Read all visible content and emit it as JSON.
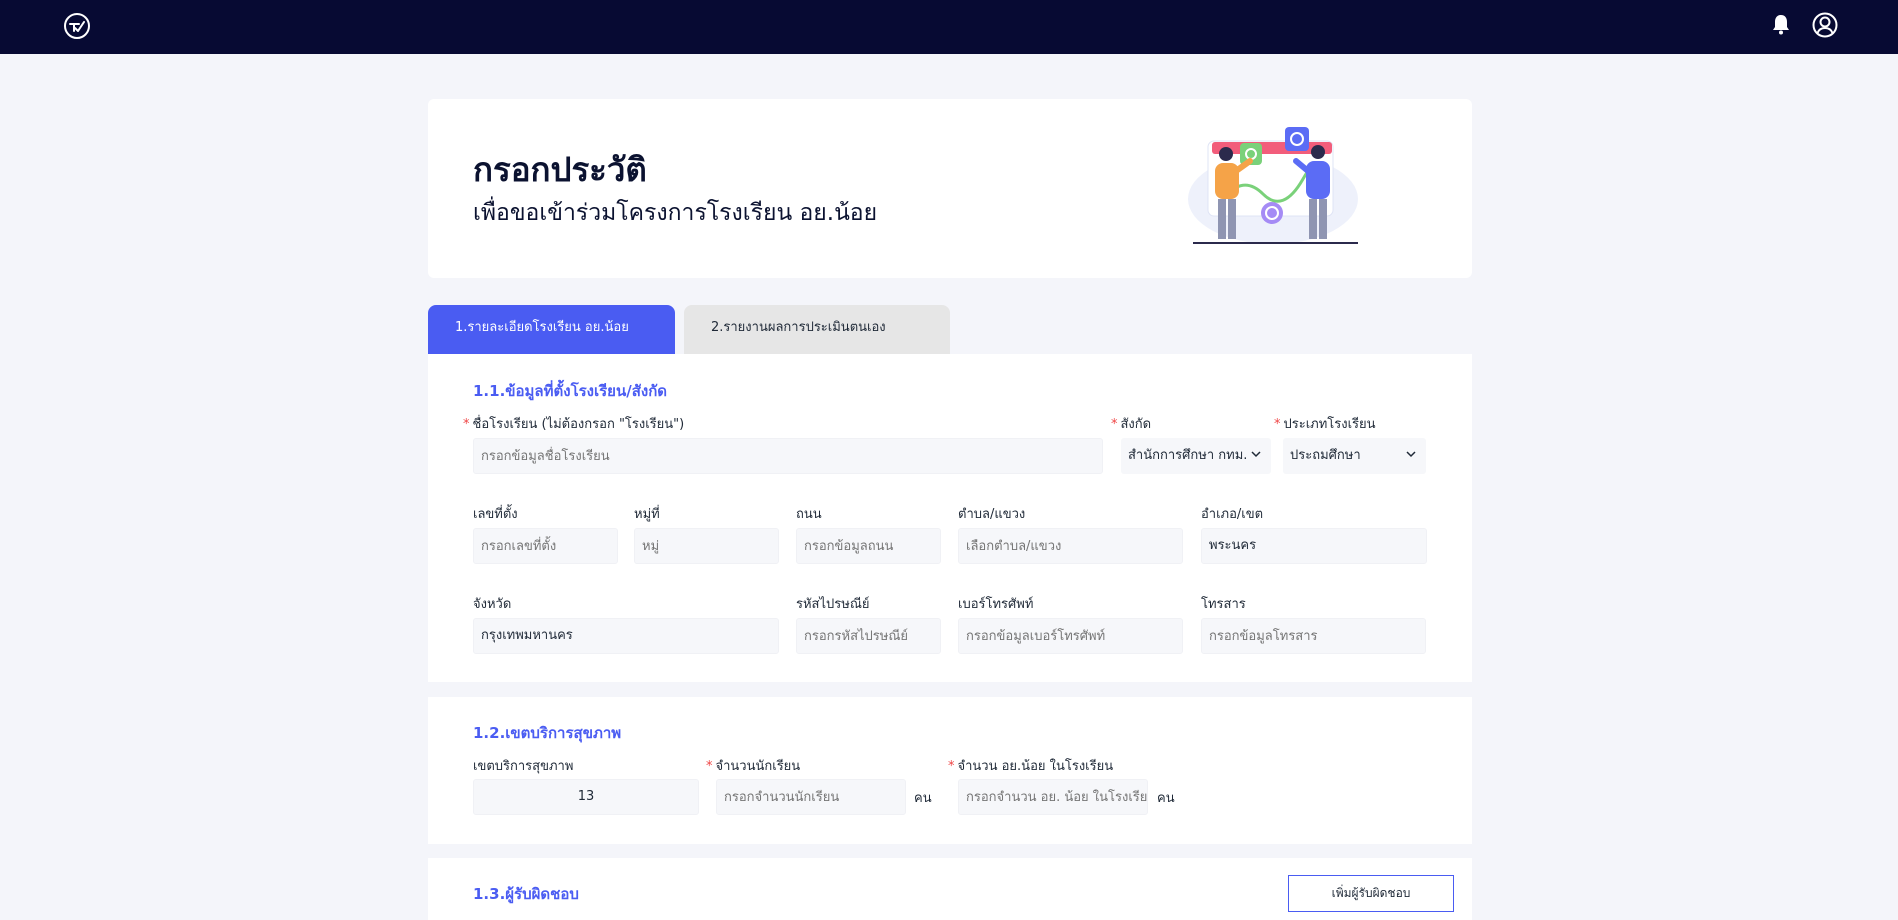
{
  "topbar": {
    "logo_icon": "check-circle-logo",
    "bell_icon": "bell-icon",
    "user_icon": "user-circle-icon",
    "bg": "#070a33"
  },
  "hero": {
    "title": "กรอกประวัติ",
    "subtitle": "เพื่อขอเข้าร่วมโครงการโรงเรียน อย.น้อย"
  },
  "tabs": [
    {
      "label": "1.รายละเอียดโรงเรียน อย.น้อย",
      "active": true
    },
    {
      "label": "2.รายงานผลการประเมินตนเอง",
      "active": false
    }
  ],
  "section1": {
    "title": "1.1.ข้อมูลที่ตั้งโรงเรียน/สังกัด",
    "school_name": {
      "label": "ชื่อโรงเรียน (ไม่ต้องกรอก \"โรงเรียน\")",
      "placeholder": "กรอกข้อมูลชื่อโรงเรียน",
      "required": "*"
    },
    "affiliation": {
      "label": "สังกัด",
      "value": "สำนักการศึกษา กทม.",
      "required": "*"
    },
    "school_type": {
      "label": "ประเภทโรงเรียน",
      "value": "ประถมศึกษา",
      "required": "*"
    },
    "house_no": {
      "label": "เลขที่ตั้ง",
      "placeholder": "กรอกเลขที่ตั้ง"
    },
    "moo": {
      "label": "หมู่ที่",
      "placeholder": "หมู่"
    },
    "road": {
      "label": "ถนน",
      "placeholder": "กรอกข้อมูลถนน"
    },
    "subdistrict": {
      "label": "ตำบล/แขวง",
      "placeholder": "เลือกตำบล/แขวง"
    },
    "district": {
      "label": "อำเภอ/เขต",
      "value": "พระนคร"
    },
    "province": {
      "label": "จังหวัด",
      "value": "กรุงเทพมหานคร"
    },
    "postcode": {
      "label": "รหัสไปรษณีย์",
      "placeholder": "กรอกรหัสไปรษณีย์"
    },
    "phone": {
      "label": "เบอร์โทรศัพท์",
      "placeholder": "กรอกข้อมูลเบอร์โทรศัพท์"
    },
    "fax": {
      "label": "โทรสาร",
      "placeholder": "กรอกข้อมูลโทรสาร"
    }
  },
  "section2": {
    "title": "1.2.เขตบริการสุขภาพ",
    "health_zone": {
      "label": "เขตบริการสุขภาพ",
      "value": "13"
    },
    "students": {
      "label": "จำนวนนักเรียน",
      "placeholder": "กรอกจำนวนนักเรียน",
      "unit": "คน",
      "required": "*"
    },
    "oryor_students": {
      "label": "จำนวน อย.น้อย ในโรงเรียน",
      "placeholder": "กรอกจำนวน อย. น้อย ในโรงเรียน",
      "unit": "คน",
      "required": "*"
    }
  },
  "section3": {
    "title": "1.3.ผู้รับผิดชอบ",
    "add_button": "เพิ่มผู้รับผิดชอบ"
  },
  "colors": {
    "accent": "#4a5cf2",
    "required": "#ef4444"
  }
}
